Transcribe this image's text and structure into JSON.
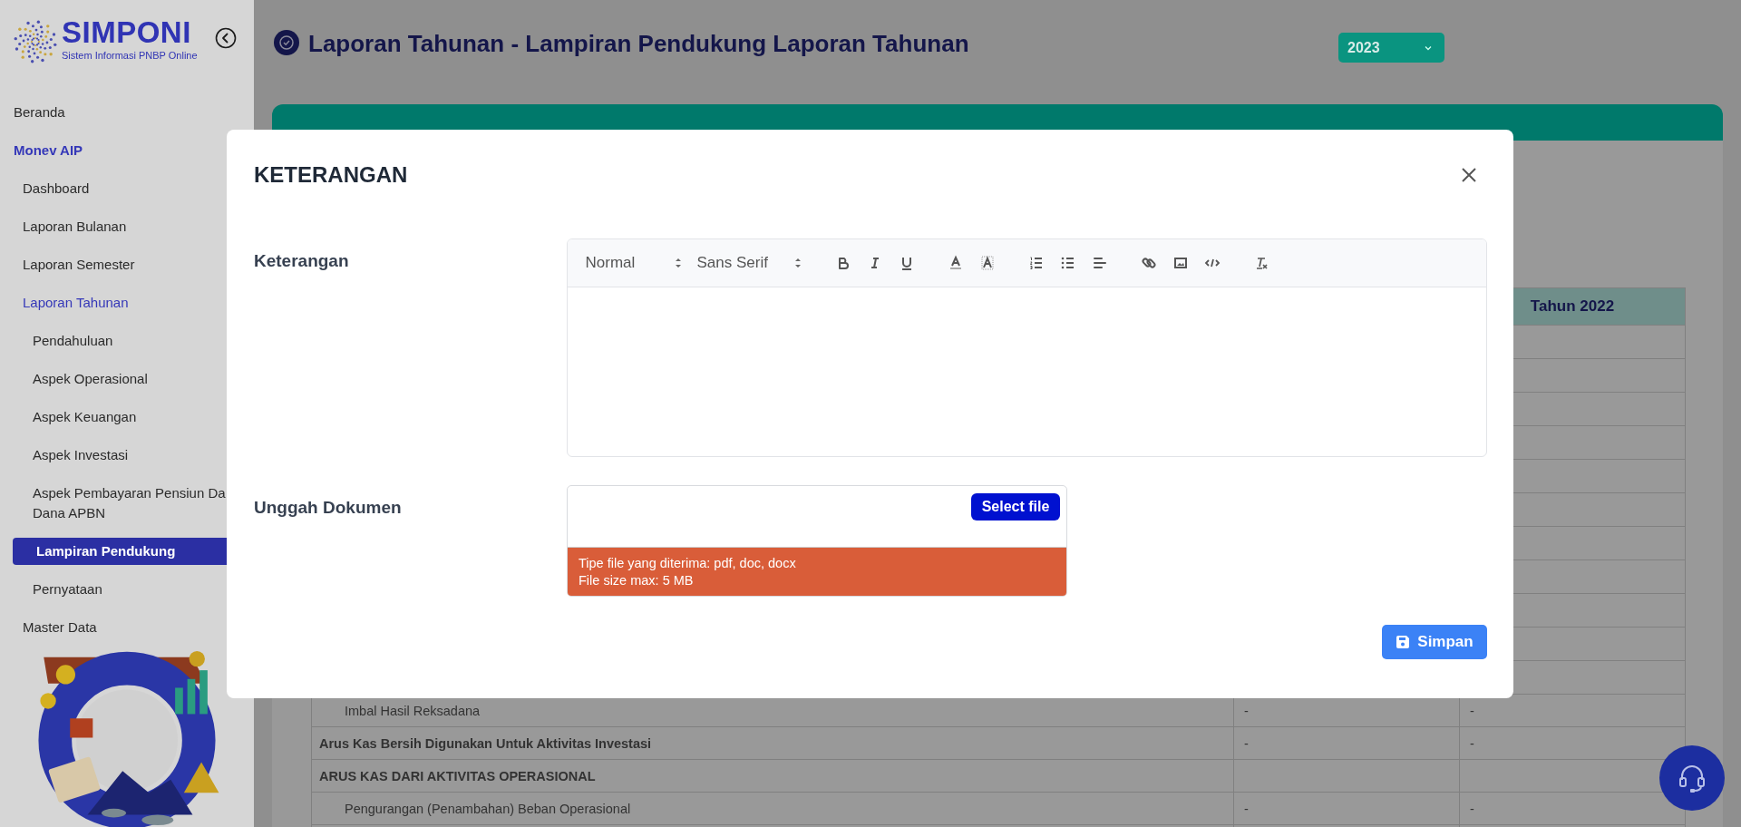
{
  "sidebar": {
    "logo": {
      "title": "SIMPONI",
      "subtitle": "Sistem Informasi PNBP Online"
    },
    "menu": [
      {
        "label": "Beranda",
        "selected": false
      },
      {
        "label": "Monev AIP",
        "selected": false,
        "expanded": true,
        "children": [
          {
            "label": "Dashboard",
            "selected": false
          },
          {
            "label": "Laporan Bulanan",
            "selected": false
          },
          {
            "label": "Laporan Semester",
            "selected": false
          },
          {
            "label": "Laporan Tahunan",
            "selected": false,
            "expanded": true,
            "children": [
              {
                "label": "Pendahuluan",
                "selected": false
              },
              {
                "label": "Aspek Operasional",
                "selected": false
              },
              {
                "label": "Aspek Keuangan",
                "selected": false
              },
              {
                "label": "Aspek Investasi",
                "selected": false
              },
              {
                "lines": [
                  "Aspek Pembayaran Pensiun Da",
                  "Dana APBN"
                ],
                "selected": false
              },
              {
                "label": "Lampiran Pendukung",
                "selected": true
              },
              {
                "label": "Pernyataan",
                "selected": false
              }
            ]
          },
          {
            "label": "Master Data",
            "selected": false
          }
        ]
      }
    ]
  },
  "page": {
    "title": "Laporan Tahunan - Lampiran Pendukung Laporan Tahunan",
    "year": "2023",
    "table": {
      "header": {
        "column_3": "Tahun 2022"
      },
      "rows": [
        {
          "kind": "item",
          "label": "Imbal Hasil Reksadana",
          "column_2": "-",
          "column_3": "-"
        },
        {
          "kind": "total",
          "label": "Arus Kas Bersih Digunakan Untuk Aktivitas Investasi",
          "column_2": "-",
          "column_3": "-"
        },
        {
          "kind": "heading",
          "label": "ARUS KAS DARI AKTIVITAS OPERASIONAL"
        },
        {
          "kind": "item",
          "label": "Pengurangan (Penambahan) Beban Operasional",
          "column_2": "-",
          "column_3": "-"
        }
      ]
    }
  },
  "modal": {
    "title": "KETERANGAN",
    "fields": [
      {
        "kind": "editor",
        "label": "Keterangan",
        "toolbar": {
          "heading": "Normal",
          "font": "Sans Serif"
        }
      },
      {
        "kind": "upload",
        "label": "Unggah Dokumen",
        "button": "Select file",
        "notes": [
          "Tipe file yang diterima: pdf, doc, docx",
          "File size max: 5 MB"
        ]
      }
    ],
    "save_button": "Simpan"
  }
}
